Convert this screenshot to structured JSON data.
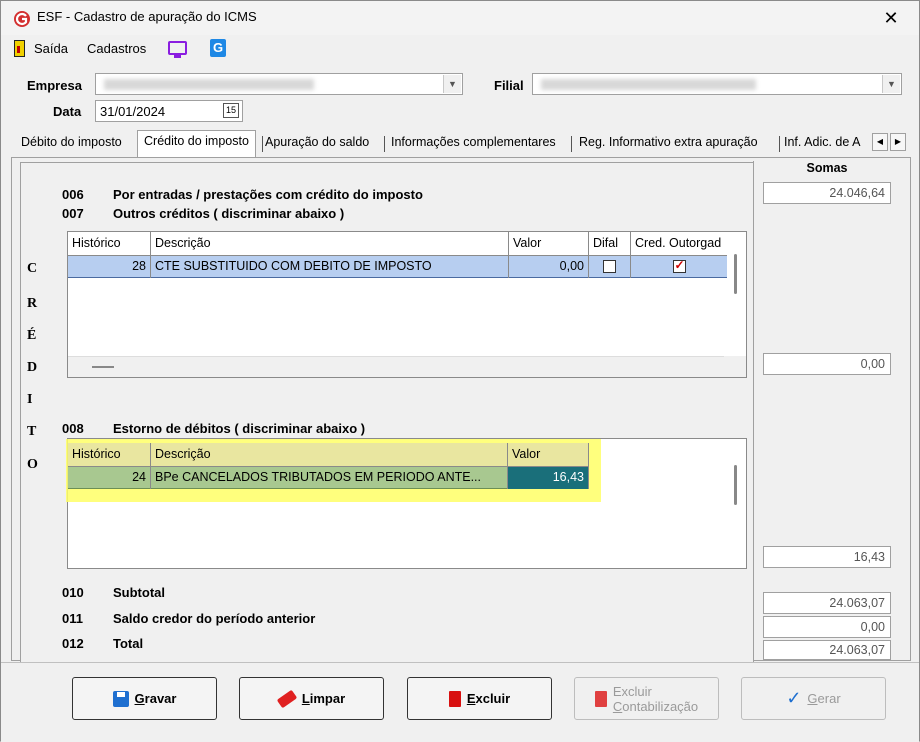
{
  "window": {
    "title": "ESF - Cadastro de apuração do ICMS",
    "close_glyph": "✕"
  },
  "menu": {
    "exit": "Saída",
    "registers": "Cadastros"
  },
  "form": {
    "company_label": "Empresa",
    "branch_label": "Filial",
    "date_label": "Data",
    "date_value": "31/01/2024",
    "date_btn": "15"
  },
  "tabs": [
    "Débito do imposto",
    "Crédito do imposto",
    "Apuração do saldo",
    "Informações complementares",
    "Reg. Informativo extra apuração",
    "Inf. Adic. de A"
  ],
  "side_letters": [
    "C",
    "R",
    "É",
    "D",
    "I",
    "T",
    "O"
  ],
  "sections": {
    "s006": {
      "code": "006",
      "text": "Por entradas / prestações com crédito do imposto"
    },
    "s007": {
      "code": "007",
      "text": "Outros créditos ( discriminar abaixo )"
    },
    "s008": {
      "code": "008",
      "text": "Estorno de débitos ( discriminar abaixo )"
    },
    "s010": {
      "code": "010",
      "text": "Subtotal"
    },
    "s011": {
      "code": "011",
      "text": "Saldo credor do período anterior"
    },
    "s012": {
      "code": "012",
      "text": "Total"
    }
  },
  "grid1": {
    "headers": [
      "Histórico",
      "Descrição",
      "Valor",
      "Difal",
      "Cred. Outorgad"
    ],
    "row": {
      "historico": "28",
      "descricao": "CTE SUBSTITUIDO COM DEBITO DE IMPOSTO",
      "valor": "0,00",
      "difal": false,
      "cred_outorgado": true
    }
  },
  "grid2": {
    "headers": [
      "Histórico",
      "Descrição",
      "Valor"
    ],
    "row": {
      "historico": "24",
      "descricao": "BPe CANCELADOS TRIBUTADOS EM PERIODO ANTE...",
      "valor": "16,43"
    }
  },
  "sums": {
    "header": "Somas",
    "s006": "24.046,64",
    "s007": "0,00",
    "s008": "16,43",
    "s010": "24.063,07",
    "s011": "0,00",
    "s012": "24.063,07"
  },
  "buttons": {
    "save_u": "G",
    "save_rest": "ravar",
    "clear_u": "L",
    "clear_rest": "impar",
    "delete_u": "E",
    "delete_rest": "xcluir",
    "unpost_line1": "Excluir",
    "unpost_u": "C",
    "unpost_rest": "ontabilização",
    "generate_u": "G",
    "generate_rest": "erar"
  },
  "colors": {
    "selected_row": "#b7cef0",
    "highlight": "#ffff66",
    "grid2_row": "#a8c890",
    "value_cell": "#1a6f7a"
  }
}
